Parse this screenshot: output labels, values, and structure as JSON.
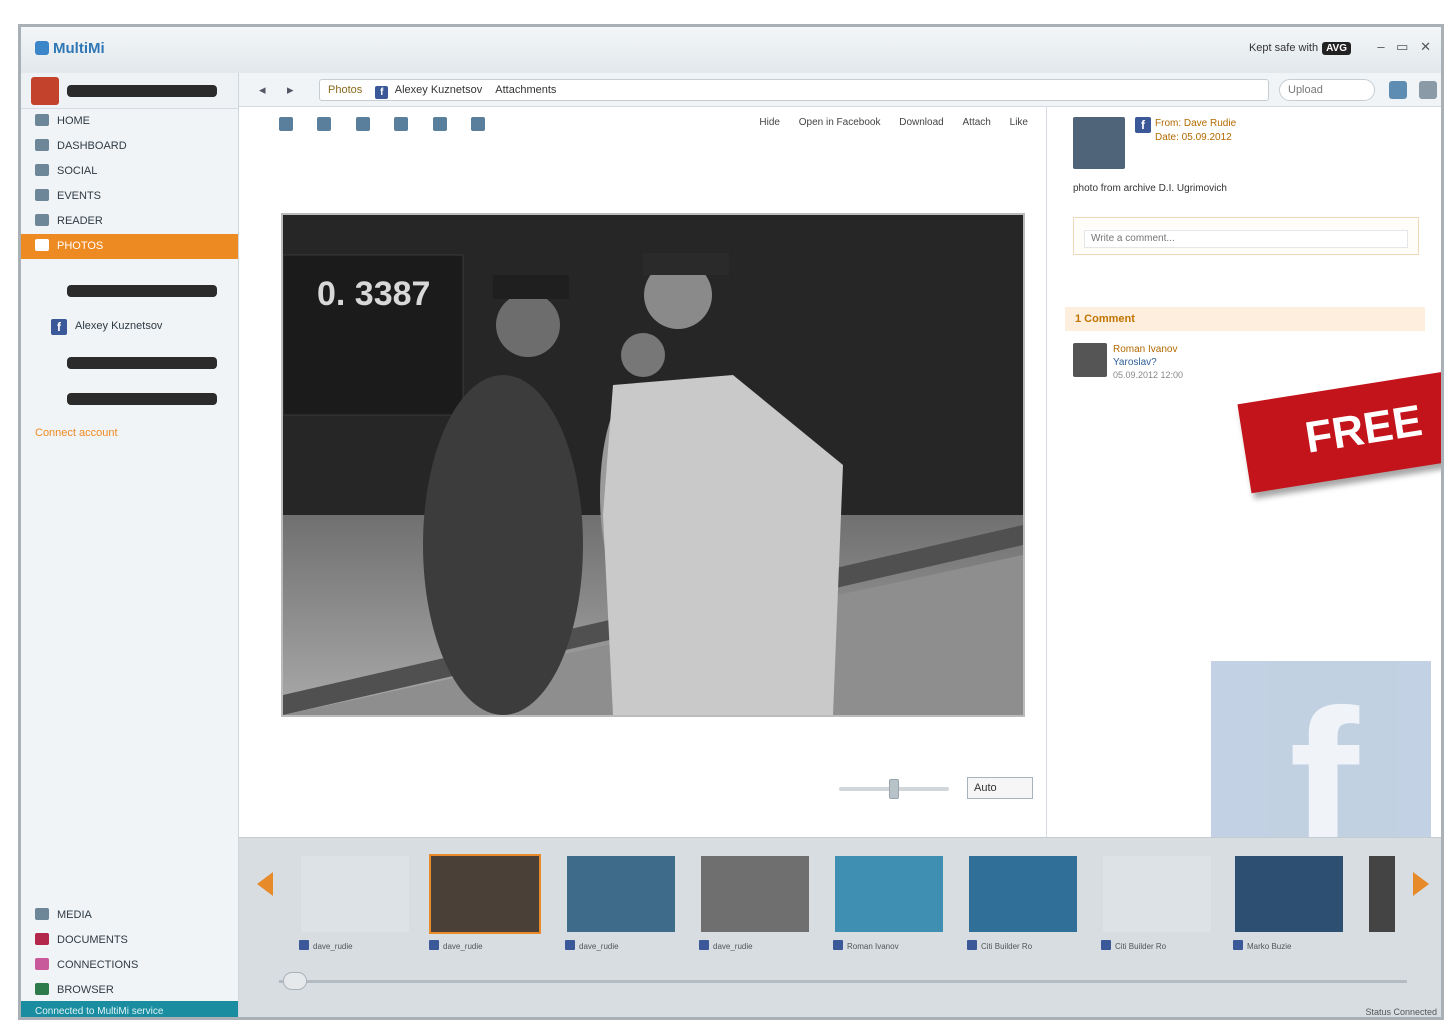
{
  "app": {
    "title": "MultiMi",
    "safe_text": "Kept safe with",
    "safe_brand": "AVG"
  },
  "window": {
    "minimize": "–",
    "restore": "▭",
    "close": "✕"
  },
  "sidebar": {
    "nav": [
      {
        "label": "HOME",
        "icon": "home-icon"
      },
      {
        "label": "DASHBOARD",
        "icon": "dashboard-icon"
      },
      {
        "label": "SOCIAL",
        "icon": "social-icon"
      },
      {
        "label": "EVENTS",
        "icon": "calendar-icon"
      },
      {
        "label": "READER",
        "icon": "reader-icon"
      },
      {
        "label": "PHOTOS",
        "icon": "photos-icon"
      }
    ],
    "account_label": "Alexey Kuznetsov",
    "connect_more": "Connect account",
    "bottom_nav": [
      {
        "label": "MEDIA",
        "icon": "media-icon"
      },
      {
        "label": "DOCUMENTS",
        "icon": "documents-icon"
      },
      {
        "label": "CONNECTIONS",
        "icon": "connections-icon"
      },
      {
        "label": "BROWSER",
        "icon": "browser-icon"
      }
    ],
    "status": "Connected to MultiMi service"
  },
  "topbar": {
    "back": "◂",
    "forward": "▸",
    "crumb_photos": "Photos",
    "crumb_account": "Alexey Kuznetsov",
    "crumb_album": "Attachments",
    "search_placeholder": "Upload"
  },
  "viewer": {
    "actions": [
      "Hide",
      "Open in Facebook",
      "Download",
      "Attach",
      "Like"
    ],
    "zoom_value": "Auto"
  },
  "details": {
    "from": "From: Dave Rudie",
    "date": "Date: 05.09.2012",
    "caption": "photo from archive D.I. Ugrimovich",
    "comment_placeholder": "Write a comment...",
    "comments_header": "1 Comment",
    "comment": {
      "name": "Roman Ivanov",
      "body": "Yaroslav?",
      "date": "05.09.2012 12:00"
    }
  },
  "badge": "FREE",
  "filmstrip": {
    "captions": [
      "dave_rudie",
      "dave_rudie",
      "dave_rudie",
      "dave_rudie",
      "Roman Ivanov",
      "Citi Builder Ro",
      "Citi Builder Ro",
      "Marko Buzie"
    ]
  },
  "status_main": "Status Connected",
  "colors": {
    "accent": "#ee8a22",
    "facebook": "#3b5998",
    "badge": "#c4141b",
    "status": "#1a8ea0"
  }
}
